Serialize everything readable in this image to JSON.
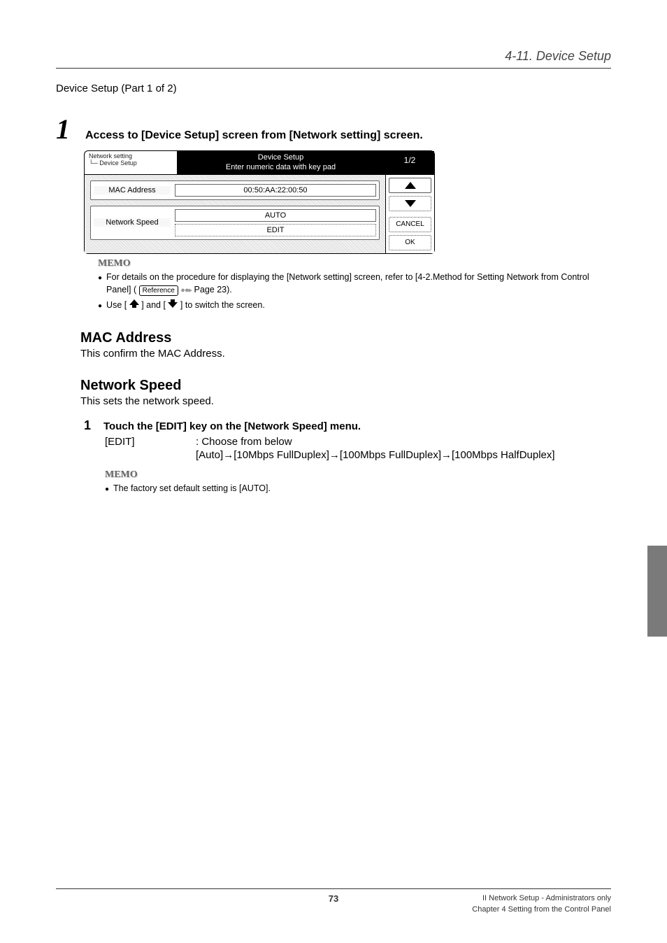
{
  "header": {
    "section": "4-11. Device Setup"
  },
  "part_label": "Device Setup (Part 1 of 2)",
  "step1": {
    "num": "1",
    "text": "Access to [Device Setup] screen from [Network setting] screen."
  },
  "screen": {
    "breadcrumb_line1": "Network setting",
    "breadcrumb_line2": "└─ Device Setup",
    "title_line1": "Device Setup",
    "title_line2": "Enter numeric data with key pad",
    "page_indicator": "1/2",
    "row1_label": "MAC Address",
    "row1_value": "00:50:AA:22:00:50",
    "row2_label": "Network Speed",
    "row2_value_top": "AUTO",
    "row2_value_bottom": "EDIT",
    "side": {
      "cancel": "CANCEL",
      "ok": "OK"
    }
  },
  "memo1": {
    "title": "MEMO",
    "item1_a": "For details on the procedure for displaying the [Network setting] screen, refer to [4-2.Method for Setting Network from Control Panel] (",
    "ref_label": "Reference",
    "item1_b": "  Page 23).",
    "item2_a": "Use [",
    "item2_b": "] and [",
    "item2_c": "] to switch the screen."
  },
  "mac": {
    "heading": "MAC Address",
    "body": "This confirm the MAC Address."
  },
  "netspeed": {
    "heading": "Network Speed",
    "body": "This sets the network speed."
  },
  "substep": {
    "num": "1",
    "text": "Touch the [EDIT] key on the [Network Speed] menu.",
    "edit_label": "[EDIT]",
    "edit_desc": ": Choose from below",
    "edit_options": "[Auto]→[10Mbps FullDuplex]→[100Mbps FullDuplex]→[100Mbps HalfDuplex]"
  },
  "memo2": {
    "title": "MEMO",
    "item1": "The factory set default setting is [AUTO]."
  },
  "footer": {
    "page": "73",
    "right_line1": "II Network Setup - Administrators only",
    "right_line2": "Chapter 4 Setting from the Control Panel"
  }
}
